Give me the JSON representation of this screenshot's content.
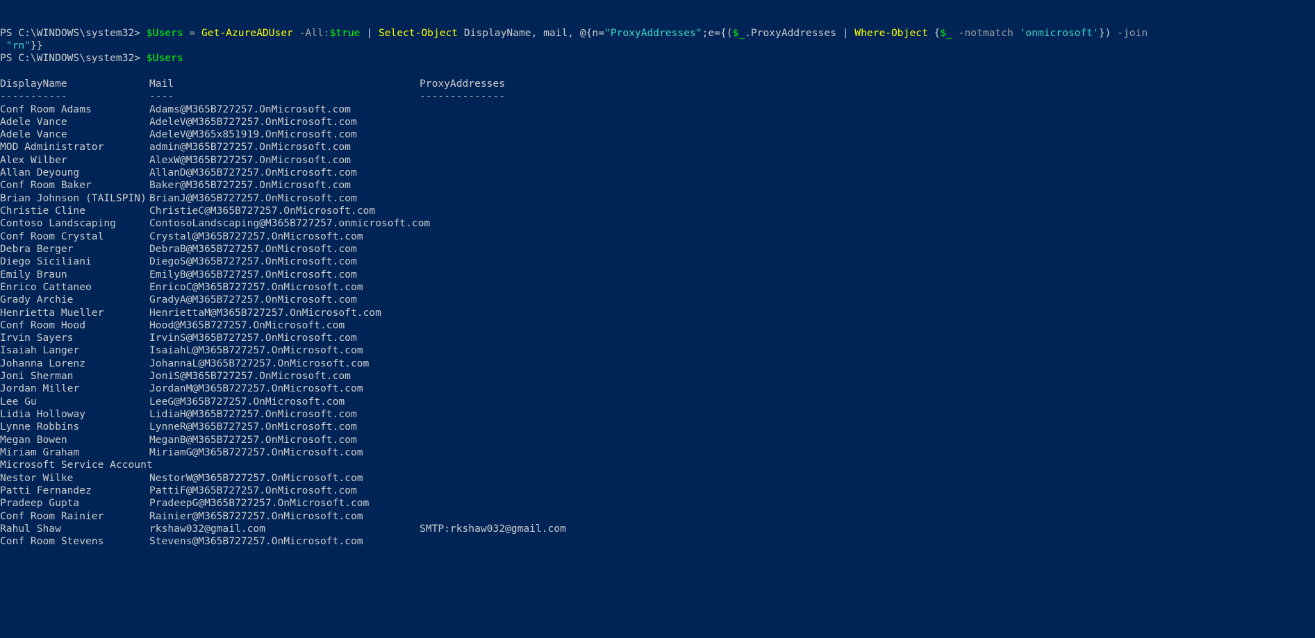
{
  "terminal": {
    "shell": "PowerShell",
    "background_color": "#012456",
    "foreground_color": "#cccccc",
    "prompt_text": "PS C:\\WINDOWS\\system32>"
  },
  "commands": [
    {
      "prompt": "PS C:\\WINDOWS\\system32>",
      "tokens": [
        {
          "t": " ",
          "c": "default"
        },
        {
          "t": "$Users",
          "c": "var"
        },
        {
          "t": " ",
          "c": "default"
        },
        {
          "t": "=",
          "c": "operator"
        },
        {
          "t": " ",
          "c": "default"
        },
        {
          "t": "Get-AzureADUser",
          "c": "cmdlet"
        },
        {
          "t": " ",
          "c": "default"
        },
        {
          "t": "-All:",
          "c": "param"
        },
        {
          "t": "$true",
          "c": "var"
        },
        {
          "t": " ",
          "c": "default"
        },
        {
          "t": "|",
          "c": "pipe"
        },
        {
          "t": " ",
          "c": "default"
        },
        {
          "t": "Select-Object",
          "c": "cmdlet"
        },
        {
          "t": " DisplayName",
          "c": "default"
        },
        {
          "t": ",",
          "c": "default"
        },
        {
          "t": " mail",
          "c": "default"
        },
        {
          "t": ",",
          "c": "default"
        },
        {
          "t": " @{n=",
          "c": "default"
        },
        {
          "t": "\"ProxyAddresses\"",
          "c": "string"
        },
        {
          "t": ";e={(",
          "c": "default"
        },
        {
          "t": "$_",
          "c": "var"
        },
        {
          "t": ".ProxyAddresses",
          "c": "default"
        },
        {
          "t": " ",
          "c": "default"
        },
        {
          "t": "|",
          "c": "pipe"
        },
        {
          "t": " ",
          "c": "default"
        },
        {
          "t": "Where-Object",
          "c": "cmdlet"
        },
        {
          "t": " {",
          "c": "default"
        },
        {
          "t": "$_",
          "c": "var"
        },
        {
          "t": " ",
          "c": "default"
        },
        {
          "t": "-notmatch",
          "c": "param"
        },
        {
          "t": " ",
          "c": "default"
        },
        {
          "t": "'onmicrosoft'",
          "c": "string"
        },
        {
          "t": "})",
          "c": "default"
        },
        {
          "t": " ",
          "c": "default"
        },
        {
          "t": "-join",
          "c": "param"
        }
      ],
      "wrapped_tokens": [
        {
          "t": " ",
          "c": "default"
        },
        {
          "t": "\"rn\"",
          "c": "string"
        },
        {
          "t": "}}",
          "c": "default"
        }
      ]
    },
    {
      "prompt": "PS C:\\WINDOWS\\system32>",
      "tokens": [
        {
          "t": " ",
          "c": "default"
        },
        {
          "t": "$Users",
          "c": "var"
        }
      ],
      "wrapped_tokens": []
    }
  ],
  "output_table": {
    "headers": [
      "DisplayName",
      "Mail",
      "ProxyAddresses"
    ],
    "separators": [
      "-----------",
      "----",
      "--------------"
    ],
    "rows": [
      {
        "DisplayName": "Conf Room Adams",
        "Mail": "Adams@M365B727257.OnMicrosoft.com",
        "ProxyAddresses": ""
      },
      {
        "DisplayName": "Adele Vance",
        "Mail": "AdeleV@M365B727257.OnMicrosoft.com",
        "ProxyAddresses": ""
      },
      {
        "DisplayName": "Adele Vance",
        "Mail": "AdeleV@M365x851919.OnMicrosoft.com",
        "ProxyAddresses": ""
      },
      {
        "DisplayName": "MOD Administrator",
        "Mail": "admin@M365B727257.OnMicrosoft.com",
        "ProxyAddresses": ""
      },
      {
        "DisplayName": "Alex Wilber",
        "Mail": "AlexW@M365B727257.OnMicrosoft.com",
        "ProxyAddresses": ""
      },
      {
        "DisplayName": "Allan Deyoung",
        "Mail": "AllanD@M365B727257.OnMicrosoft.com",
        "ProxyAddresses": ""
      },
      {
        "DisplayName": "Conf Room Baker",
        "Mail": "Baker@M365B727257.OnMicrosoft.com",
        "ProxyAddresses": ""
      },
      {
        "DisplayName": "Brian Johnson (TAILSPIN)",
        "Mail": "BrianJ@M365B727257.OnMicrosoft.com",
        "ProxyAddresses": ""
      },
      {
        "DisplayName": "Christie Cline",
        "Mail": "ChristieC@M365B727257.OnMicrosoft.com",
        "ProxyAddresses": ""
      },
      {
        "DisplayName": "Contoso Landscaping",
        "Mail": "ContosoLandscaping@M365B727257.onmicrosoft.com",
        "ProxyAddresses": ""
      },
      {
        "DisplayName": "Conf Room Crystal",
        "Mail": "Crystal@M365B727257.OnMicrosoft.com",
        "ProxyAddresses": ""
      },
      {
        "DisplayName": "Debra Berger",
        "Mail": "DebraB@M365B727257.OnMicrosoft.com",
        "ProxyAddresses": ""
      },
      {
        "DisplayName": "Diego Siciliani",
        "Mail": "DiegoS@M365B727257.OnMicrosoft.com",
        "ProxyAddresses": ""
      },
      {
        "DisplayName": "Emily Braun",
        "Mail": "EmilyB@M365B727257.OnMicrosoft.com",
        "ProxyAddresses": ""
      },
      {
        "DisplayName": "Enrico Cattaneo",
        "Mail": "EnricoC@M365B727257.OnMicrosoft.com",
        "ProxyAddresses": ""
      },
      {
        "DisplayName": "Grady Archie",
        "Mail": "GradyA@M365B727257.OnMicrosoft.com",
        "ProxyAddresses": ""
      },
      {
        "DisplayName": "Henrietta Mueller",
        "Mail": "HenriettaM@M365B727257.OnMicrosoft.com",
        "ProxyAddresses": ""
      },
      {
        "DisplayName": "Conf Room Hood",
        "Mail": "Hood@M365B727257.OnMicrosoft.com",
        "ProxyAddresses": ""
      },
      {
        "DisplayName": "Irvin Sayers",
        "Mail": "IrvinS@M365B727257.OnMicrosoft.com",
        "ProxyAddresses": ""
      },
      {
        "DisplayName": "Isaiah Langer",
        "Mail": "IsaiahL@M365B727257.OnMicrosoft.com",
        "ProxyAddresses": ""
      },
      {
        "DisplayName": "Johanna Lorenz",
        "Mail": "JohannaL@M365B727257.OnMicrosoft.com",
        "ProxyAddresses": ""
      },
      {
        "DisplayName": "Joni Sherman",
        "Mail": "JoniS@M365B727257.OnMicrosoft.com",
        "ProxyAddresses": ""
      },
      {
        "DisplayName": "Jordan Miller",
        "Mail": "JordanM@M365B727257.OnMicrosoft.com",
        "ProxyAddresses": ""
      },
      {
        "DisplayName": "Lee Gu",
        "Mail": "LeeG@M365B727257.OnMicrosoft.com",
        "ProxyAddresses": ""
      },
      {
        "DisplayName": "Lidia Holloway",
        "Mail": "LidiaH@M365B727257.OnMicrosoft.com",
        "ProxyAddresses": ""
      },
      {
        "DisplayName": "Lynne Robbins",
        "Mail": "LynneR@M365B727257.OnMicrosoft.com",
        "ProxyAddresses": ""
      },
      {
        "DisplayName": "Megan Bowen",
        "Mail": "MeganB@M365B727257.OnMicrosoft.com",
        "ProxyAddresses": ""
      },
      {
        "DisplayName": "Miriam Graham",
        "Mail": "MiriamG@M365B727257.OnMicrosoft.com",
        "ProxyAddresses": ""
      },
      {
        "DisplayName": "Microsoft Service Account",
        "Mail": "",
        "ProxyAddresses": ""
      },
      {
        "DisplayName": "Nestor Wilke",
        "Mail": "NestorW@M365B727257.OnMicrosoft.com",
        "ProxyAddresses": ""
      },
      {
        "DisplayName": "Patti Fernandez",
        "Mail": "PattiF@M365B727257.OnMicrosoft.com",
        "ProxyAddresses": ""
      },
      {
        "DisplayName": "Pradeep Gupta",
        "Mail": "PradeepG@M365B727257.OnMicrosoft.com",
        "ProxyAddresses": ""
      },
      {
        "DisplayName": "Conf Room Rainier",
        "Mail": "Rainier@M365B727257.OnMicrosoft.com",
        "ProxyAddresses": ""
      },
      {
        "DisplayName": "Rahul Shaw",
        "Mail": "rkshaw032@gmail.com",
        "ProxyAddresses": "SMTP:rkshaw032@gmail.com"
      },
      {
        "DisplayName": "Conf Room Stevens",
        "Mail": "Stevens@M365B727257.OnMicrosoft.com",
        "ProxyAddresses": ""
      }
    ]
  }
}
